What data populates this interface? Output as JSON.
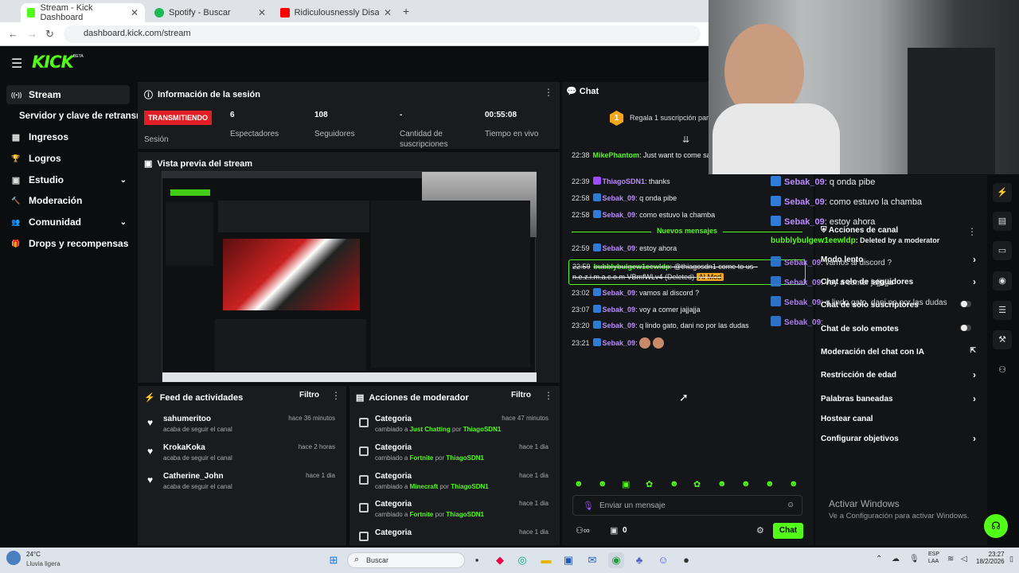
{
  "browser": {
    "tabs": [
      {
        "label": "Stream - Kick Dashboard",
        "close": "✕"
      },
      {
        "label": "Spotify - Buscar",
        "close": "✕"
      },
      {
        "label": "Ridiculousnessly Disastrous Del",
        "close": "✕"
      }
    ],
    "new_tab": "+",
    "url": "dashboard.kick.com/stream"
  },
  "header": {
    "logo": "KICK",
    "beta": "BETA",
    "menu_icon": "☰"
  },
  "sidebar": {
    "items": [
      {
        "label": "Stream",
        "icon": "((•))"
      },
      {
        "label": "Servidor y clave de retransm",
        "icon": ""
      },
      {
        "label": "Ingresos",
        "icon": "▦"
      },
      {
        "label": "Logros",
        "icon": "🏆"
      },
      {
        "label": "Estudio",
        "icon": "▣",
        "chev": "⌄"
      },
      {
        "label": "Moderación",
        "icon": "🔨"
      },
      {
        "label": "Comunidad",
        "icon": "👥",
        "chev": "⌄"
      },
      {
        "label": "Drops y recompensas",
        "icon": "🎁"
      }
    ]
  },
  "session": {
    "title": "Información de la sesión",
    "live_badge": "TRANSMITIENDO",
    "live_label": "Sesión",
    "stats": [
      {
        "value": "6",
        "label": "Espectadores"
      },
      {
        "value": "108",
        "label": "Seguidores"
      },
      {
        "value": "-",
        "label": "Cantidad de suscripciones"
      },
      {
        "value": "00:55:08",
        "label": "Tiempo en vivo"
      }
    ]
  },
  "preview": {
    "title": "Vista previa del stream"
  },
  "feed": {
    "title": "Feed de actividades",
    "filter": "Filtro",
    "rows": [
      {
        "name": "sahumeritoo",
        "sub": "acaba de seguir el canal",
        "time": "hace 36 minutos"
      },
      {
        "name": "KrokaKoka",
        "sub": "acaba de seguir el canal",
        "time": "hace 2 horas"
      },
      {
        "name": "Catherine_John",
        "sub": "acaba de seguir el canal",
        "time": "hace 1 dia"
      }
    ]
  },
  "mod": {
    "title": "Acciones de moderador",
    "filter": "Filtro",
    "rows": [
      {
        "name": "Categoria",
        "pre": "cambiado a",
        "cat": "Just Chatting",
        "by": "por",
        "user": "ThiagoSDN1",
        "time": "hace 47 minutos"
      },
      {
        "name": "Categoria",
        "pre": "cambiado a",
        "cat": "Fortnite",
        "by": "por",
        "user": "ThiagoSDN1",
        "time": "hace 1 dia"
      },
      {
        "name": "Categoria",
        "pre": "cambiado a",
        "cat": "Minecraft",
        "by": "por",
        "user": "ThiagoSDN1",
        "time": "hace 1 dia"
      },
      {
        "name": "Categoria",
        "pre": "cambiado a",
        "cat": "Fortnite",
        "by": "por",
        "user": "ThiagoSDN1",
        "time": "hace 1 dia"
      },
      {
        "name": "Categoria",
        "pre": "",
        "cat": "",
        "by": "",
        "user": "",
        "time": "hace 1 dia"
      }
    ]
  },
  "chat": {
    "title": "Chat",
    "gift_count": "1",
    "gift_text": "Regala 1 suscripción para",
    "messages": [
      {
        "time": "22:38",
        "user": "MikePhantom",
        "text": ": Just want to come sa positivity!",
        "color": "mike"
      },
      {
        "time": "22:39",
        "user": "ThiagoSDN1",
        "text": ": thanks",
        "color": "green"
      },
      {
        "time": "22:58",
        "user": "Sebak_09",
        "text": ": q onda pibe",
        "color": "purple"
      },
      {
        "time": "22:58",
        "user": "Sebak_09",
        "text": ": como estuvo la chamba",
        "color": "purple"
      }
    ],
    "new_label": "Nuevos mensajes",
    "messages2": [
      {
        "time": "22:59",
        "user": "Sebak_09",
        "text": ": estoy ahora",
        "color": "purple"
      },
      {
        "time": "23:02",
        "user": "Sebak_09",
        "text": ": vamos al discord ?",
        "color": "purple"
      },
      {
        "time": "23:07",
        "user": "Sebak_09",
        "text": ": voy a comer jajjajja",
        "color": "purple"
      },
      {
        "time": "23:20",
        "user": "Sebak_09",
        "text": ": q lindo gato, dani no por las dudas",
        "color": "purple"
      },
      {
        "time": "23:21",
        "user": "Sebak_09",
        "text": ":",
        "color": "purple"
      }
    ],
    "deleted": {
      "time": "22:59",
      "user": "bubblybulgew1eewldp",
      "text": ": @thiagosdn1 come to us - n.e.z.i.m.a.c.o.m VBmfWLv4",
      "tag": "(Deleted)",
      "ai": "AI Mod"
    },
    "input_placeholder": "Enviar un mensaje",
    "count": "0",
    "send": "Chat"
  },
  "overlay": {
    "messages": [
      {
        "user": "Sebak_09",
        "text": ": q onda pibe"
      },
      {
        "user": "Sebak_09",
        "text": ": como estuvo la chamba"
      },
      {
        "user": "Sebak_09",
        "text": ": estoy ahora"
      }
    ],
    "deleted_user": "bubblybulgew1eewldp",
    "deleted_text": ": Deleted by a moderator",
    "more": [
      {
        "user": "Sebak_09",
        "text": ": vamos al discord ?"
      },
      {
        "user": "Sebak_09",
        "text": ": voy a comer jajjajja"
      },
      {
        "user": "Sebak_09",
        "text": ": q lindo gato, dani no por las dudas"
      },
      {
        "user": "Sebak_09",
        "text": ":"
      }
    ],
    "menu_title": "Acciones de canal",
    "menu": [
      {
        "label": "Modo lento",
        "kind": "chev"
      },
      {
        "label": "Chat solo de seguidores",
        "kind": "chev"
      },
      {
        "label": "Chat de solo suscriptores",
        "kind": "toggle"
      },
      {
        "label": "Chat de solo emotes",
        "kind": "toggle"
      },
      {
        "label": "Moderación del chat con IA",
        "kind": "ext"
      },
      {
        "label": "Restricción de edad",
        "kind": "chev"
      },
      {
        "label": "Palabras baneadas",
        "kind": "chev"
      },
      {
        "label": "Hostear canal",
        "kind": "none"
      },
      {
        "label": "Configurar objetivos",
        "kind": "chev"
      }
    ]
  },
  "activate": {
    "title": "Activar Windows",
    "sub": "Ve a Configuración para activar Windows."
  },
  "taskbar": {
    "weather_temp": "24°C",
    "weather_desc": "Lluvia ligera",
    "search": "Buscar",
    "lang1": "ESP",
    "lang2": "LAA",
    "time": "23:27",
    "date": "18/2/2026"
  }
}
